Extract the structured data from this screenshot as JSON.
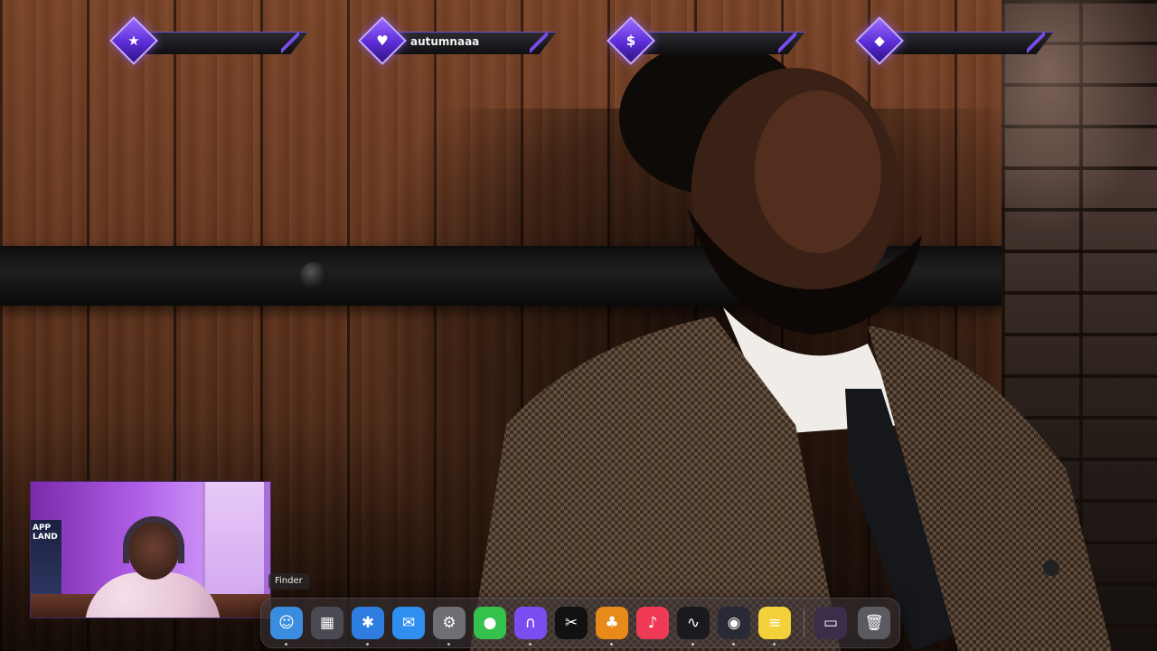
{
  "screen": {
    "wallpaper": "portrait-photo-wallpaper"
  },
  "badges": [
    {
      "icon": "star-icon",
      "glyph": "★",
      "label": ""
    },
    {
      "icon": "heart-icon",
      "glyph": "♥",
      "label": "autumnaaa"
    },
    {
      "icon": "dollar-icon",
      "glyph": "$",
      "label": ""
    },
    {
      "icon": "diamond-icon",
      "glyph": "◆",
      "label": ""
    }
  ],
  "webcam": {
    "poster_text": "APP LAND"
  },
  "dock": {
    "tooltip": "Finder",
    "apps": [
      {
        "name": "finder",
        "glyph": "☺",
        "bg": "#3a8dde"
      },
      {
        "name": "launchpad",
        "glyph": "▦",
        "bg": "#4a4a52"
      },
      {
        "name": "safari",
        "glyph": "✱",
        "bg": "#2f7de0"
      },
      {
        "name": "mail",
        "glyph": "✉",
        "bg": "#2f8ff0"
      },
      {
        "name": "system-settings",
        "glyph": "⚙",
        "bg": "#6e6e74"
      },
      {
        "name": "messages",
        "glyph": "●",
        "bg": "#35c24c"
      },
      {
        "name": "arc",
        "glyph": "∩",
        "bg": "#7b4cf0"
      },
      {
        "name": "capcut",
        "glyph": "✂",
        "bg": "#111111"
      },
      {
        "name": "fl-studio",
        "glyph": "♣",
        "bg": "#e88a1a"
      },
      {
        "name": "music",
        "glyph": "♪",
        "bg": "#f03a55"
      },
      {
        "name": "waveform",
        "glyph": "∿",
        "bg": "#1a1a1e"
      },
      {
        "name": "obs",
        "glyph": "◉",
        "bg": "#2a2a36"
      },
      {
        "name": "notes",
        "glyph": "≡",
        "bg": "#f4d03a"
      },
      {
        "name": "preview-thumbnail",
        "glyph": "▭",
        "bg": "#3a2e4a"
      },
      {
        "name": "trash",
        "glyph": "🗑",
        "bg": "#5a5a60"
      }
    ]
  }
}
